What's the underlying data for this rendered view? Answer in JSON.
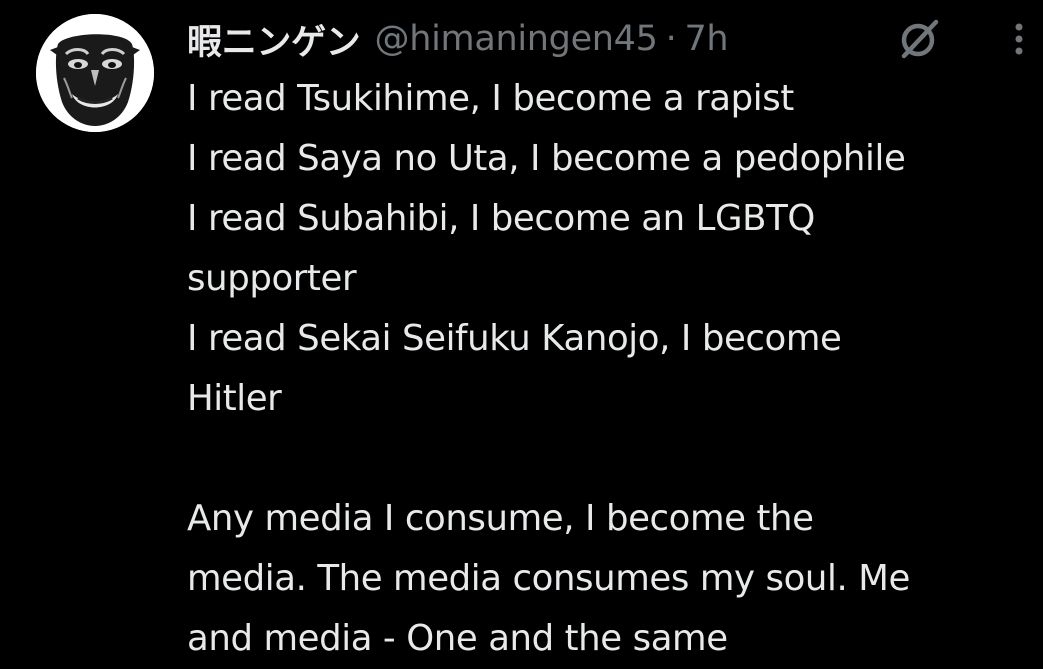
{
  "tweet": {
    "author": {
      "display_name": "暇ニンゲン",
      "handle": "@himaningen45",
      "avatar_icon": "avatar-image"
    },
    "separator": "·",
    "time": "7h",
    "header_icons": [
      "grok-icon",
      "more-icon"
    ],
    "text": {
      "line_1": "I read Tsukihime, I become a rapist",
      "line_2": "I read Saya no Uta, I become a pedophile",
      "line_3": "I read Subahibi, I become an LGBTQ",
      "line_4": "supporter",
      "line_5": "I read Sekai Seifuku Kanojo, I become",
      "line_6": "Hitler",
      "line_7": "Any media I consume, I become the",
      "line_8": "media. The media consumes my soul. Me",
      "line_9": "and media - One and the same"
    }
  },
  "colors": {
    "background": "#000000",
    "primary_text": "#e7e9ea",
    "secondary_text": "#71767b"
  }
}
